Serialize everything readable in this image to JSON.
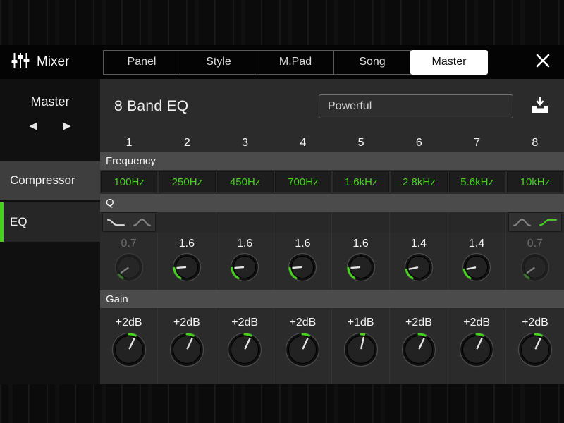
{
  "header": {
    "app_title": "Mixer",
    "tabs": [
      {
        "label": "Panel",
        "active": false
      },
      {
        "label": "Style",
        "active": false
      },
      {
        "label": "M.Pad",
        "active": false
      },
      {
        "label": "Song",
        "active": false
      },
      {
        "label": "Master",
        "active": true
      }
    ]
  },
  "icons": {
    "prev": "◀",
    "next": "▶"
  },
  "sidebar": {
    "selector_label": "Master",
    "items": [
      {
        "label": "Compressor",
        "active": false
      },
      {
        "label": "EQ",
        "active": true
      }
    ]
  },
  "eq": {
    "title": "8 Band EQ",
    "preset": "Powerful",
    "band_numbers": [
      "1",
      "2",
      "3",
      "4",
      "5",
      "6",
      "7",
      "8"
    ],
    "frequency": {
      "label": "Frequency",
      "values": [
        "100Hz",
        "250Hz",
        "450Hz",
        "700Hz",
        "1.6kHz",
        "2.8kHz",
        "5.6kHz",
        "10kHz"
      ]
    },
    "q": {
      "label": "Q",
      "values": [
        "0.7",
        "1.6",
        "1.6",
        "1.6",
        "1.6",
        "1.4",
        "1.4",
        "0.7"
      ],
      "disabled_bands": [
        1,
        8
      ],
      "filter_type_icons": {
        "band1": [
          {
            "icon": "low-shelf-icon",
            "color": "#d8d8d8"
          },
          {
            "icon": "peak-icon",
            "color": "#858585"
          }
        ],
        "band8": [
          {
            "icon": "peak-icon",
            "color": "#858585"
          },
          {
            "icon": "high-shelf-icon",
            "color": "#45d21d"
          }
        ]
      }
    },
    "gain": {
      "label": "Gain",
      "values": [
        "+2dB",
        "+2dB",
        "+2dB",
        "+2dB",
        "+1dB",
        "+2dB",
        "+2dB",
        "+2dB"
      ]
    }
  },
  "colors": {
    "accent_green": "#45d21d",
    "panel_bg": "#2b2b2b",
    "section_bar_bg": "#4b4b4b",
    "selected_tab_bg": "#ffffff"
  }
}
